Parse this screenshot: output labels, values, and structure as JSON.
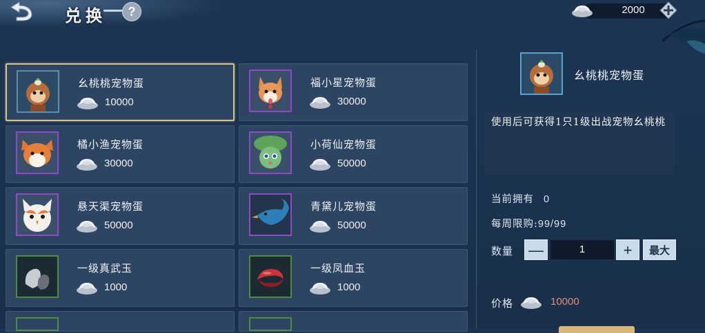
{
  "header": {
    "title": "兑换",
    "help_label": "?"
  },
  "currency": {
    "amount": "2000",
    "icon": "silver-ingot-icon",
    "add_icon": "plus-icon"
  },
  "items": [
    {
      "name": "幺桃桃宠物蛋",
      "price": "10000",
      "icon": "monkey-pet-icon",
      "frame": "blue",
      "selected": true
    },
    {
      "name": "福小星宠物蛋",
      "price": "30000",
      "icon": "corgi-pet-icon",
      "frame": "purple"
    },
    {
      "name": "橘小渔宠物蛋",
      "price": "30000",
      "icon": "orange-cat-pet-icon",
      "frame": "purple"
    },
    {
      "name": "小荷仙宠物蛋",
      "price": "50000",
      "icon": "lotus-fairy-pet-icon",
      "frame": "purple"
    },
    {
      "name": "悬天渠宠物蛋",
      "price": "50000",
      "icon": "owl-pet-icon",
      "frame": "purple"
    },
    {
      "name": "青黛儿宠物蛋",
      "price": "50000",
      "icon": "blue-bird-pet-icon",
      "frame": "purple"
    },
    {
      "name": "一级真武玉",
      "price": "1000",
      "icon": "grey-jade-icon",
      "frame": "green"
    },
    {
      "name": "一级凤血玉",
      "price": "1000",
      "icon": "red-jade-icon",
      "frame": "green"
    }
  ],
  "detail": {
    "name": "幺桃桃宠物蛋",
    "description": "使用后可获得1只1级出战宠物幺桃桃",
    "owned_label": "当前拥有",
    "owned_value": "0",
    "limit_label": "每周限购:",
    "limit_value": "99/99",
    "qty_label": "数量",
    "qty_minus": "—",
    "qty_value": "1",
    "qty_plus": "+",
    "max_label": "最大",
    "price_label": "价格",
    "price_value": "10000"
  },
  "colors": {
    "price_text": "#e88b78",
    "selected_border": "#d8c58b",
    "panel_bg": "#2d4462"
  }
}
